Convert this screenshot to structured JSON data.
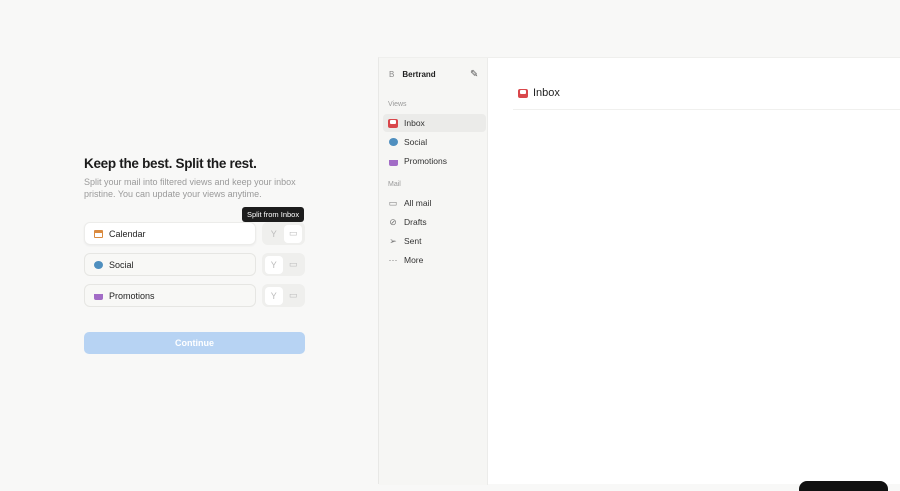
{
  "onboarding": {
    "title": "Keep the best. Split the rest.",
    "subtitle": "Split your mail into filtered views and keep your inbox pristine. You can update your views anytime.",
    "tooltip": "Split from Inbox",
    "views": [
      {
        "label": "Calendar",
        "icon": "calendar-icon"
      },
      {
        "label": "Social",
        "icon": "chat-bubble-icon"
      },
      {
        "label": "Promotions",
        "icon": "basket-icon"
      }
    ],
    "continue_label": "Continue"
  },
  "sidebar": {
    "user_initial": "B",
    "user_name": "Bertrand",
    "views_heading": "Views",
    "views": [
      {
        "label": "Inbox",
        "icon": "inbox-icon"
      },
      {
        "label": "Social",
        "icon": "chat-bubble-icon"
      },
      {
        "label": "Promotions",
        "icon": "basket-icon"
      }
    ],
    "mail_heading": "Mail",
    "mail": [
      {
        "label": "All mail",
        "icon": "all-mail-icon"
      },
      {
        "label": "Drafts",
        "icon": "drafts-icon"
      },
      {
        "label": "Sent",
        "icon": "sent-icon"
      },
      {
        "label": "More",
        "icon": "more-icon"
      }
    ]
  },
  "main": {
    "title": "Inbox"
  },
  "colors": {
    "accent": "#b7d3f3",
    "inbox": "#d9474b",
    "social": "#4f8fbf",
    "promotions": "#a26cc6"
  }
}
